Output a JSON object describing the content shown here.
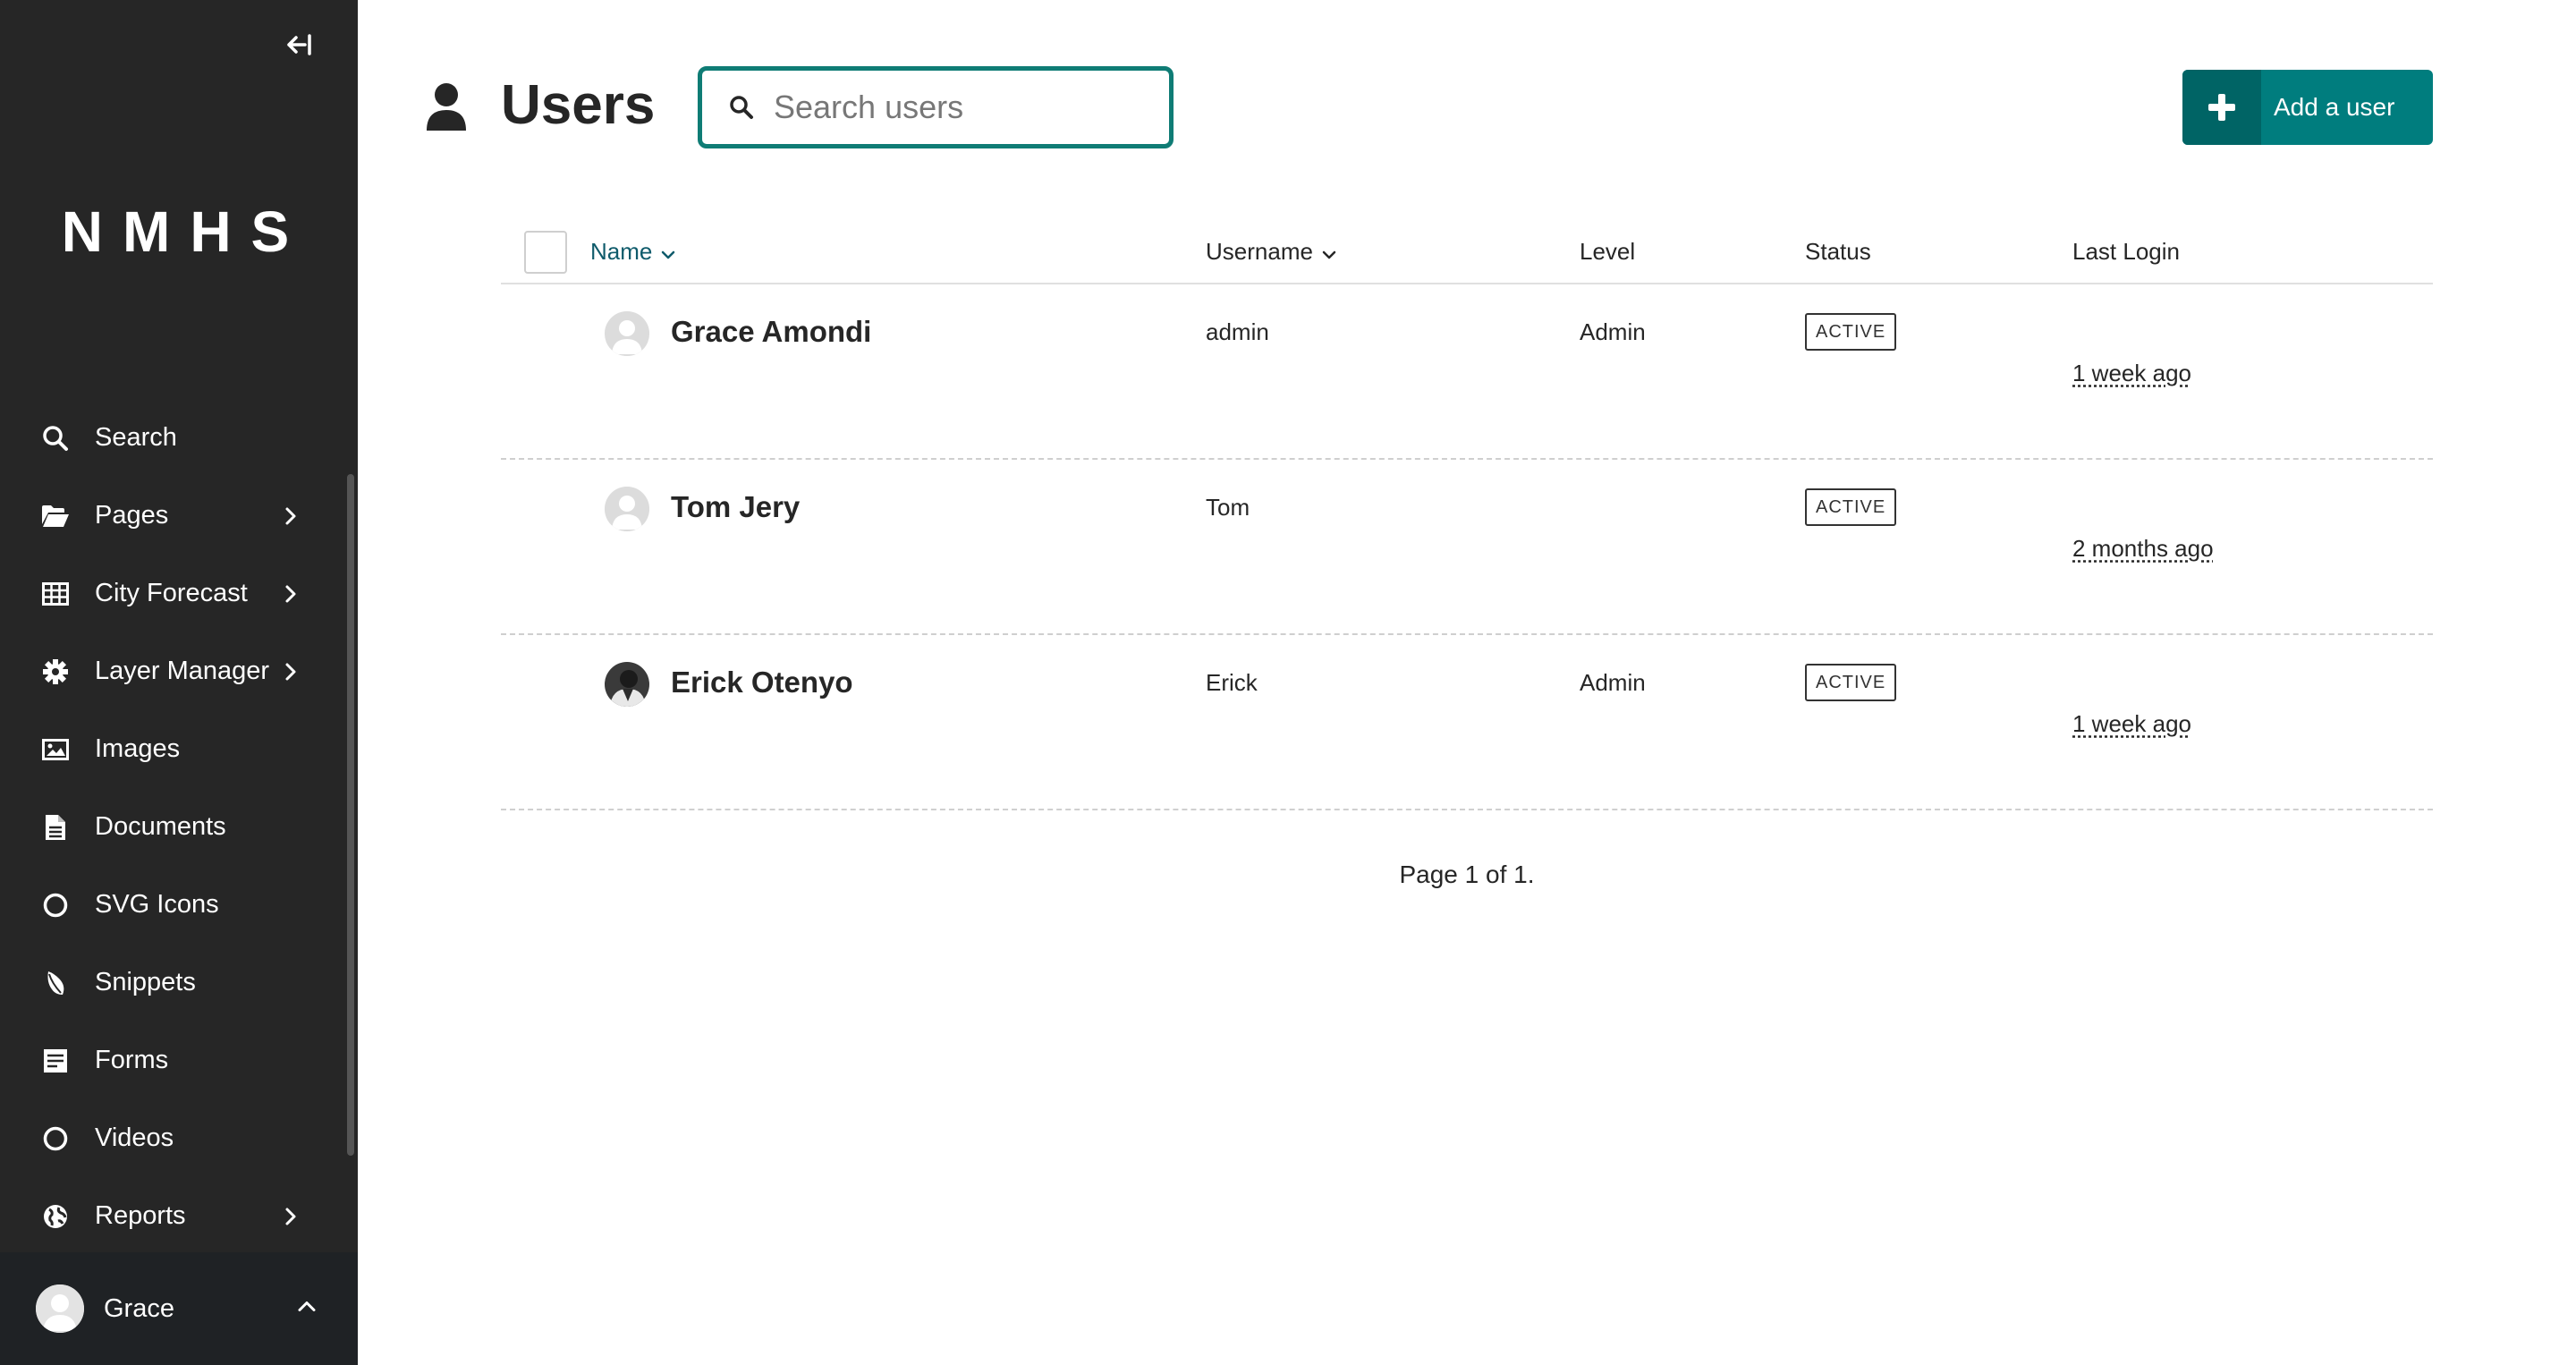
{
  "sidebar": {
    "logo": "NMHS",
    "items": [
      {
        "label": "Search",
        "icon": "search-icon",
        "has_submenu": false
      },
      {
        "label": "Pages",
        "icon": "folder-open-icon",
        "has_submenu": true
      },
      {
        "label": "City Forecast",
        "icon": "table-icon",
        "has_submenu": true
      },
      {
        "label": "Layer Manager",
        "icon": "cog-icon",
        "has_submenu": true
      },
      {
        "label": "Images",
        "icon": "image-icon",
        "has_submenu": false
      },
      {
        "label": "Documents",
        "icon": "document-icon",
        "has_submenu": false
      },
      {
        "label": "SVG Icons",
        "icon": "circle-icon",
        "has_submenu": false
      },
      {
        "label": "Snippets",
        "icon": "snippet-icon",
        "has_submenu": false
      },
      {
        "label": "Forms",
        "icon": "form-icon",
        "has_submenu": false
      },
      {
        "label": "Videos",
        "icon": "circle-icon",
        "has_submenu": false
      },
      {
        "label": "Reports",
        "icon": "globe-icon",
        "has_submenu": true
      }
    ],
    "account": {
      "name": "Grace"
    }
  },
  "header": {
    "title": "Users",
    "search_placeholder": "Search users",
    "add_button_label": "Add a user"
  },
  "table": {
    "columns": {
      "name": "Name",
      "username": "Username",
      "level": "Level",
      "status": "Status",
      "last_login": "Last Login"
    },
    "rows": [
      {
        "name": "Grace Amondi",
        "username": "admin",
        "level": "Admin",
        "status": "ACTIVE",
        "last_login": "1 week ago",
        "avatar": "default"
      },
      {
        "name": "Tom Jery",
        "username": "Tom",
        "level": "",
        "status": "ACTIVE",
        "last_login": "2 months ago",
        "avatar": "default"
      },
      {
        "name": "Erick Otenyo",
        "username": "Erick",
        "level": "Admin",
        "status": "ACTIVE",
        "last_login": "1 week ago",
        "avatar": "photo"
      }
    ]
  },
  "pagination": "Page 1 of 1.",
  "colors": {
    "sidebar_bg": "#262626",
    "accent": "#007d7e",
    "accent_dark": "#006465",
    "search_border": "#0f7c75",
    "link": "#0f5b6b"
  }
}
